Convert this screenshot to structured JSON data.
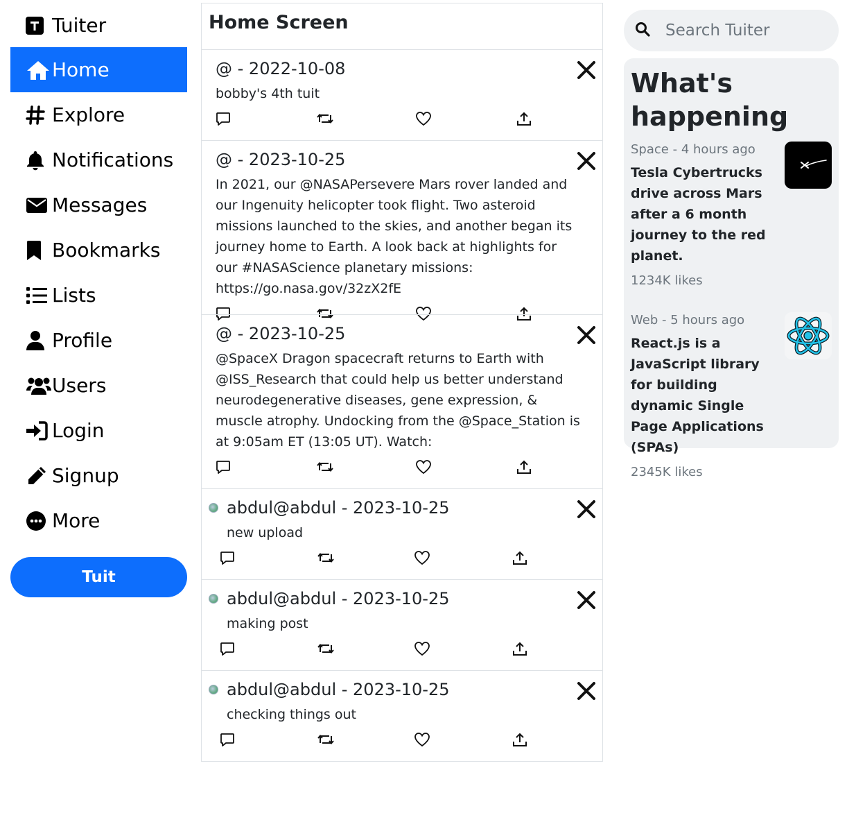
{
  "brand": {
    "name": "Tuiter"
  },
  "nav": [
    {
      "id": "home",
      "label": "Home",
      "icon": "house-icon",
      "active": true
    },
    {
      "id": "explore",
      "label": "Explore",
      "icon": "hashtag-icon"
    },
    {
      "id": "notifications",
      "label": "Notifications",
      "icon": "bell-icon"
    },
    {
      "id": "messages",
      "label": "Messages",
      "icon": "envelope-icon"
    },
    {
      "id": "bookmarks",
      "label": "Bookmarks",
      "icon": "bookmark-icon"
    },
    {
      "id": "lists",
      "label": "Lists",
      "icon": "list-icon"
    },
    {
      "id": "profile",
      "label": "Profile",
      "icon": "user-icon"
    },
    {
      "id": "users",
      "label": "Users",
      "icon": "users-icon"
    },
    {
      "id": "login",
      "label": "Login",
      "icon": "login-icon"
    },
    {
      "id": "signup",
      "label": "Signup",
      "icon": "pencil-icon"
    },
    {
      "id": "more",
      "label": "More",
      "icon": "ellipsis-circle-icon"
    }
  ],
  "tuit_button": {
    "label": "Tuit"
  },
  "feed": {
    "title": "Home Screen",
    "tuits": [
      {
        "author": "@",
        "date": "2022-10-08",
        "text": "bobby's 4th tuit",
        "avatar": false
      },
      {
        "author": "@",
        "date": "2023-10-25",
        "text": "In 2021, our @NASAPersevere Mars rover landed and our Ingenuity helicopter took flight. Two asteroid missions launched to the skies, and another began its journey home to Earth. A look back at highlights for our #NASAScience planetary missions: https://go.nasa.gov/32zX2fE",
        "avatar": false
      },
      {
        "author": "@",
        "date": "2023-10-25",
        "text": "@SpaceX Dragon spacecraft returns to Earth with @ISS_Research that could help us better understand neurodegenerative diseases, gene expression, & muscle atrophy. Undocking from the @Space_Station is at 9:05am ET (13:05 UT). Watch:",
        "avatar": false
      },
      {
        "author": "abdul@abdul",
        "date": "2023-10-25",
        "text": "new upload",
        "avatar": true
      },
      {
        "author": "abdul@abdul",
        "date": "2023-10-25",
        "text": "making post",
        "avatar": true
      },
      {
        "author": "abdul@abdul",
        "date": "2023-10-25",
        "text": "checking things out",
        "avatar": true
      }
    ]
  },
  "search": {
    "placeholder": "Search Tuiter"
  },
  "happening": {
    "title": "What's happening",
    "trends": [
      {
        "topic": "Space",
        "time": "4 hours ago",
        "headline": "Tesla Cybertrucks drive across Mars after a 6 month journey to the red planet.",
        "likes": "1234K likes",
        "thumb": "spacex-logo"
      },
      {
        "topic": "Web",
        "time": "5 hours ago",
        "headline": "React.js is a JavaScript library for building dynamic Single Page Applications (SPAs)",
        "likes": "2345K likes",
        "thumb": "react-logo"
      }
    ]
  },
  "colors": {
    "primary": "#0d6efd",
    "panel": "#eff1f3",
    "border": "#dee2e6",
    "muted": "#6c757d"
  }
}
